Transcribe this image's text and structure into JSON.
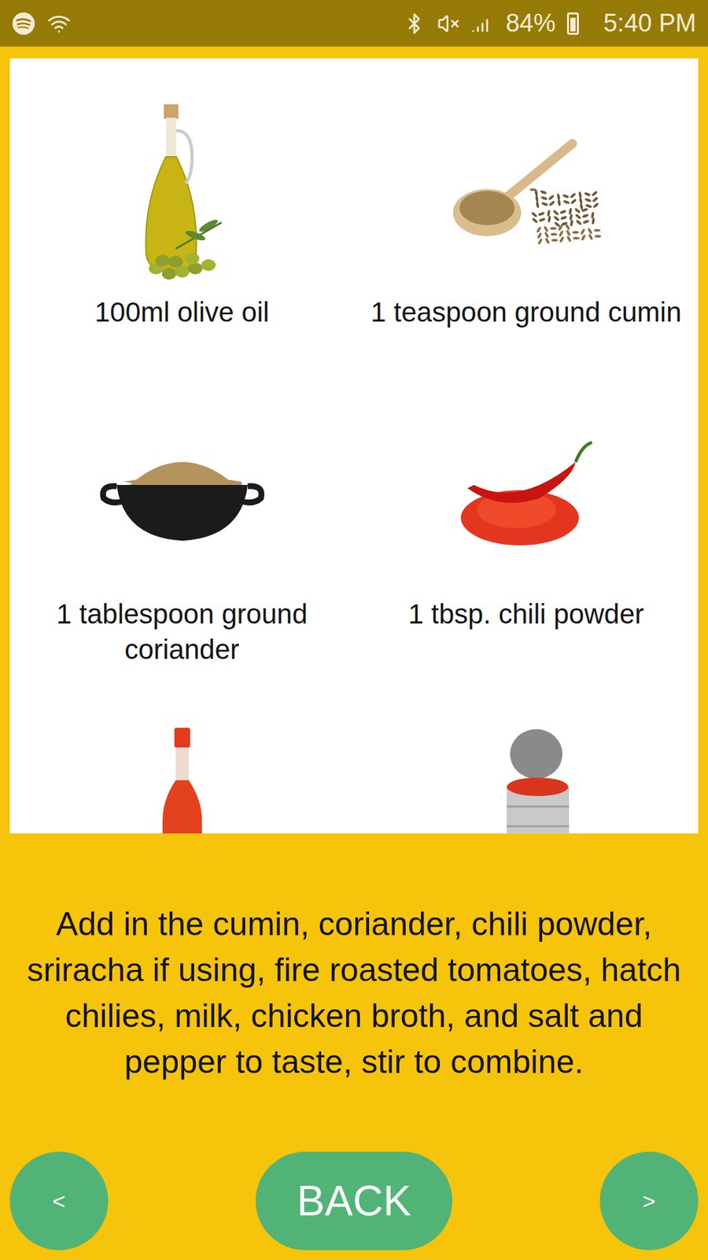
{
  "status_bar": {
    "battery": "84%",
    "battery_level": 0.84,
    "time": "5:40 PM"
  },
  "ingredients": [
    {
      "kind": "oil",
      "label": "100ml olive oil"
    },
    {
      "kind": "cumin",
      "label": "1 teaspoon ground cumin"
    },
    {
      "kind": "coriander",
      "label": "1 tablespoon ground coriander"
    },
    {
      "kind": "chili",
      "label": "1 tbsp. chili powder"
    },
    {
      "kind": "hot-sauce"
    },
    {
      "kind": "canned-tomatoes"
    }
  ],
  "instruction": "Add in the cumin, coriander, chili powder, sriracha if using, fire roasted tomatoes, hatch chilies, milk, chicken broth, and salt and pepper to taste, stir to combine.",
  "buttons": {
    "previous": "<",
    "back": "BACK",
    "next": ">"
  }
}
